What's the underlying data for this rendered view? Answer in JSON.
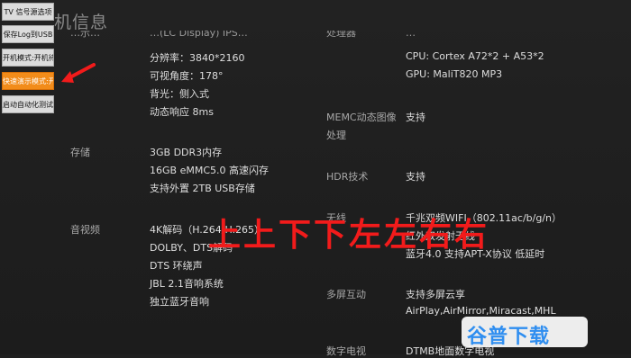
{
  "page_title": "机信息",
  "debug_buttons": [
    "TV 信号源选项",
    "保存Log到USB",
    "开机模式:开机待机",
    "快速演示模式:开",
    "启动自动化测试"
  ],
  "top_cut": {
    "left": "…示…",
    "mid": "…(LC Display) IPS…",
    "right_label": "处理器",
    "right_val": "…"
  },
  "left": {
    "display_rows": [
      "分辨率：3840*2160",
      "可视角度：178°",
      "背光：侧入式",
      "动态响应 8ms"
    ],
    "storage_label": "存储",
    "storage_rows": [
      "3GB DDR3内存",
      "16GB eMMC5.0 高速闪存",
      "支持外置 2TB USB存储"
    ],
    "av_label": "音视频",
    "av_rows": [
      "4K解码（H.264/H.265）",
      "DOLBY、DTS解码",
      "DTS 环绕声",
      "JBL 2.1音响系统",
      "独立蓝牙音响"
    ]
  },
  "right": {
    "cpu": "CPU:   Cortex A72*2 + A53*2",
    "gpu": "GPU:   MaliT820 MP3",
    "memc_label_1": "MEMC动态图像",
    "memc_label_2": "处理",
    "memc_val": "支持",
    "hdr_label": "HDR技术",
    "hdr_val": "支持",
    "wireless_label": "无线",
    "wireless_rows": [
      "千兆双频WIFI（802.11ac/b/g/n）",
      "红外双发射无线",
      "蓝牙4.0 支持APT-X协议 低延时"
    ],
    "multiscreen_label": "多屏互动",
    "multiscreen_rows": [
      "支持多屏云享",
      "AirPlay,AirMirror,Miracast,MHL"
    ],
    "dtv_label": "数字电视",
    "dtv_val": "DTMB地面数字电视"
  },
  "overlay_text": "上上下下左左右右",
  "watermark": "谷普下载",
  "colors": {
    "accent": "#f28c1a",
    "overlay": "#f21b1b",
    "watermark": "#2f8ef0"
  }
}
